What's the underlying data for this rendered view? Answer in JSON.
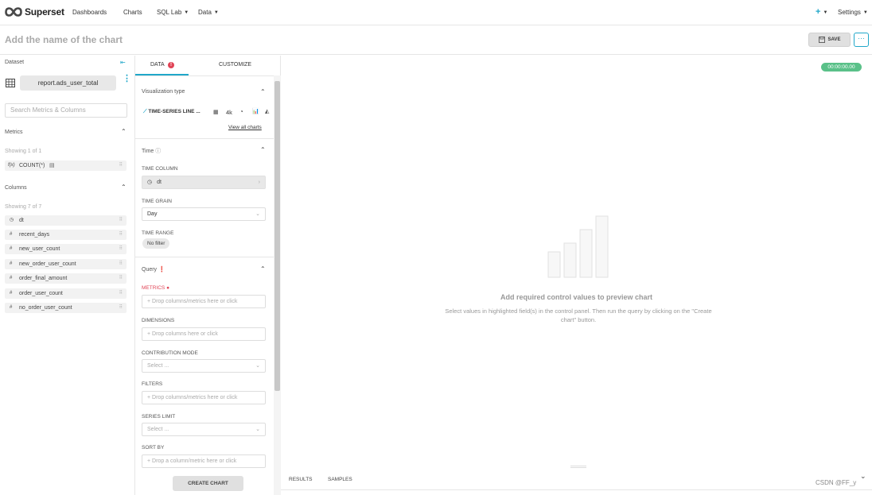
{
  "nav": {
    "brand": "Superset",
    "items": [
      "Dashboards",
      "Charts",
      "SQL Lab",
      "Data"
    ],
    "plus": "+",
    "settings": "Settings"
  },
  "header": {
    "title_placeholder": "Add the name of the chart",
    "save_label": "SAVE",
    "more_label": "···"
  },
  "dataset": {
    "heading": "Dataset",
    "name": "report.ads_user_total",
    "search_placeholder": "Search Metrics & Columns",
    "metrics_heading": "Metrics",
    "metrics_showing": "Showing 1 of 1",
    "metrics": [
      {
        "icon": "f(x)",
        "name": "COUNT(*)"
      }
    ],
    "columns_heading": "Columns",
    "columns_showing": "Showing 7 of 7",
    "columns": [
      {
        "icon": "clock",
        "name": "dt"
      },
      {
        "icon": "#",
        "name": "recent_days"
      },
      {
        "icon": "#",
        "name": "new_user_count"
      },
      {
        "icon": "#",
        "name": "new_order_user_count"
      },
      {
        "icon": "#",
        "name": "order_final_amount"
      },
      {
        "icon": "#",
        "name": "order_user_count"
      },
      {
        "icon": "#",
        "name": "no_order_user_count"
      }
    ]
  },
  "controls": {
    "tabs": [
      "DATA",
      "CUSTOMIZE"
    ],
    "viz_heading": "Visualization type",
    "viz_name": "TIME-SERIES LINE ...",
    "viz_4k": "4k",
    "view_all": "View all charts",
    "time_heading": "Time",
    "time_column_label": "TIME COLUMN",
    "time_column_value": "dt",
    "time_grain_label": "TIME GRAIN",
    "time_grain_value": "Day",
    "time_range_label": "TIME RANGE",
    "time_range_value": "No filter",
    "query_heading": "Query",
    "metrics_label": "METRICS",
    "metrics_placeholder": "Drop columns/metrics here or click",
    "dimensions_label": "DIMENSIONS",
    "dimensions_placeholder": "Drop columns here or click",
    "contribution_label": "CONTRIBUTION MODE",
    "contribution_placeholder": "Select ...",
    "filters_label": "FILTERS",
    "filters_placeholder": "Drop columns/metrics here or click",
    "series_limit_label": "SERIES LIMIT",
    "series_limit_placeholder": "Select ...",
    "sort_by_label": "SORT BY",
    "sort_by_placeholder": "Drop a column/metric here or click",
    "create_chart": "CREATE CHART"
  },
  "preview": {
    "timer": "00:00:00.00",
    "empty_title": "Add required control values to preview chart",
    "empty_desc": "Select values in highlighted field(s) in the control panel. Then run the query by clicking on the \"Create chart\" button.",
    "bottom_tabs": [
      "RESULTS",
      "SAMPLES"
    ]
  },
  "watermark": "CSDN @FF_y",
  "colors": {
    "accent": "#20a7c9",
    "error": "#e04355",
    "success": "#5ac189"
  }
}
